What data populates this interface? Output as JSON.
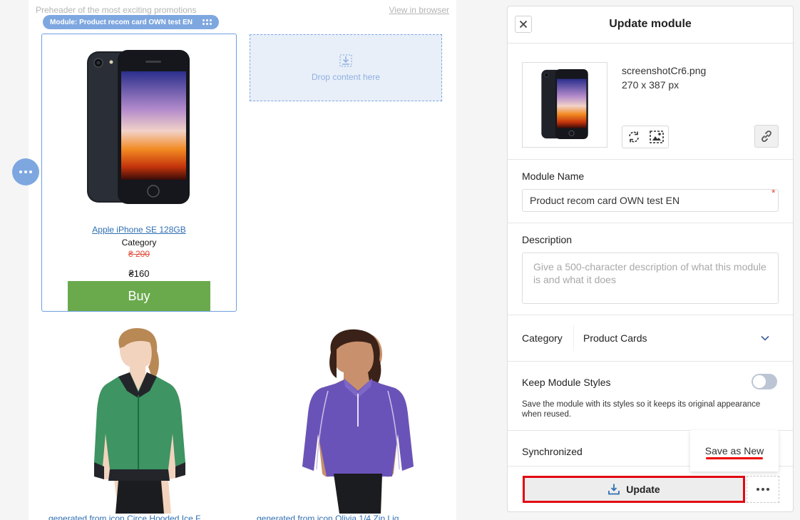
{
  "canvas": {
    "preheader": "Preheader of the most exciting promotions",
    "view_in_browser": "View in browser",
    "module_tag": "Module: Product recom card OWN test EN",
    "product": {
      "name": "Apple iPhone SE 128GB",
      "category": "Category",
      "old_price": "₴ 200",
      "price": "₴160",
      "buy_label": "Buy"
    },
    "drop_zone_label": "Drop content here",
    "apparel": [
      {
        "caption": "generated from icon Circe Hooded Ice F"
      },
      {
        "caption": "generated from icon Olivia 1/4 Zip Lig"
      }
    ]
  },
  "panel": {
    "title": "Update module",
    "image": {
      "file_name": "screenshotCr6.png",
      "dimensions": "270 x 387 px"
    },
    "module_name": {
      "label": "Module Name",
      "value": "Product recom card OWN test EN",
      "required_mark": "*"
    },
    "description": {
      "label": "Description",
      "placeholder": "Give a 500-character description of what this module is and what it does"
    },
    "category": {
      "label": "Category",
      "value": "Product Cards"
    },
    "keep_styles": {
      "label": "Keep Module Styles",
      "enabled": false,
      "help": "Save the module with its styles so it keeps its original appearance when reused."
    },
    "synchronized": {
      "label": "Synchronized"
    },
    "save_as_new_label": "Save as New",
    "update_label": "Update"
  },
  "icons": {
    "close": "close-icon",
    "grip": "drag-handle-icon",
    "drop": "download-icon",
    "replace": "replace-image-icon",
    "crop": "crop-image-icon",
    "link": "link-icon",
    "chevron": "chevron-down-icon",
    "update": "download-tray-icon",
    "more": "more-horizontal-icon",
    "fab": "more-horizontal-icon"
  },
  "colors": {
    "accent": "#7ea7e0",
    "selection_border": "#6d9fdf",
    "buy_button": "#6aaa4d",
    "old_price": "#e04b3a",
    "link": "#2f6fb3",
    "highlight_red": "#e30613"
  }
}
